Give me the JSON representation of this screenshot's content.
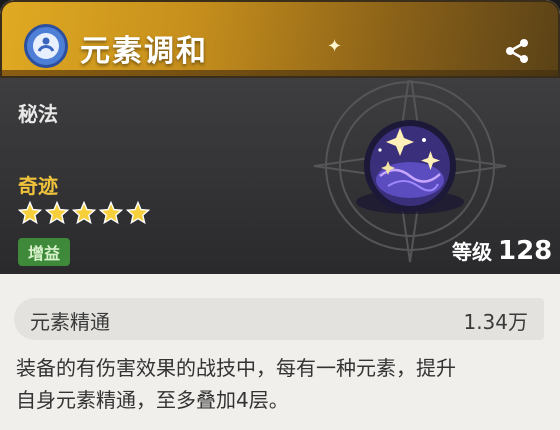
{
  "header": {
    "title": "元素调和",
    "type_icon": "element-mastery-icon",
    "share_icon": "share-icon",
    "background": "#d9a020"
  },
  "item": {
    "category": "秘法",
    "rarity_label": "奇迹",
    "stars": 5,
    "tag": "增益",
    "level_label": "等级",
    "level_value": "128",
    "orb_icon": "crystal-orb-icon"
  },
  "stat": {
    "label": "元素精通",
    "value": "1.34万"
  },
  "description": "装备的有伤害效果的战技中，每有一种元素，提升\n自身元素精通，至多叠加4层。",
  "colors": {
    "accent_gold": "#f0c23c",
    "tag_green": "#3e8a3a",
    "icon_blue": "#4e7fd7"
  }
}
